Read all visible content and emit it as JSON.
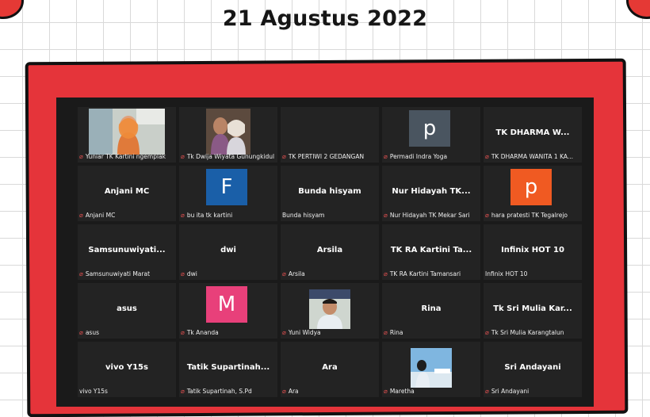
{
  "header": {
    "date_title": "21 Agustus 2022"
  },
  "colors": {
    "frame_red": "#e5343a",
    "tile_bg": "#232323",
    "mute_red": "#e05050"
  },
  "participants": [
    {
      "label": "Yuniar TK Kartini ngemplak",
      "muted": true,
      "kind": "video",
      "video": "woman-hijab-orange"
    },
    {
      "label": "Tk Dwija Wiyata Gunungkidul",
      "muted": true,
      "kind": "video",
      "video": "two-women"
    },
    {
      "label": "TK PERTIWI 2 GEDANGAN",
      "muted": true,
      "kind": "blank"
    },
    {
      "label": "Permadi Indra Yoga",
      "muted": true,
      "kind": "avatar",
      "letter": "p",
      "avatar_color": "#4a5560"
    },
    {
      "label": "TK DHARMA WANITA 1 KA...",
      "muted": true,
      "kind": "name",
      "center": "TK DHARMA W..."
    },
    {
      "label": "Anjani MC",
      "muted": true,
      "kind": "name",
      "center": "Anjani MC"
    },
    {
      "label": "bu ita tk kartini",
      "muted": true,
      "kind": "avatar",
      "letter": "F",
      "avatar_color": "#1a5fa8"
    },
    {
      "label": "Bunda hisyam",
      "muted": false,
      "kind": "name",
      "center": "Bunda hisyam"
    },
    {
      "label": "Nur Hidayah TK Mekar Sari",
      "muted": true,
      "kind": "name",
      "center": "Nur Hidayah TK..."
    },
    {
      "label": "hara pratesti TK Tegalrejo",
      "muted": true,
      "kind": "avatar",
      "letter": "p",
      "avatar_color": "#f05a22"
    },
    {
      "label": "Samsunuwiyati Marat",
      "muted": true,
      "kind": "name",
      "center": "Samsunuwiyati..."
    },
    {
      "label": "dwi",
      "muted": true,
      "kind": "name",
      "center": "dwi"
    },
    {
      "label": "Arsila",
      "muted": true,
      "kind": "name",
      "center": "Arsila"
    },
    {
      "label": "TK RA Kartini Tamansari",
      "muted": true,
      "kind": "name",
      "center": "TK RA Kartini Ta..."
    },
    {
      "label": "Infinix HOT 10",
      "muted": false,
      "kind": "name",
      "center": "Infinix HOT 10"
    },
    {
      "label": "asus",
      "muted": true,
      "kind": "name",
      "center": "asus"
    },
    {
      "label": "Tk Ananda",
      "muted": true,
      "kind": "avatar",
      "letter": "M",
      "avatar_color": "#e8407a"
    },
    {
      "label": "Yuni Widya",
      "muted": true,
      "kind": "video",
      "video": "man-office"
    },
    {
      "label": "Rina",
      "muted": true,
      "kind": "name",
      "center": "Rina"
    },
    {
      "label": "Tk Sri Mulia Karangtalun",
      "muted": true,
      "kind": "name",
      "center": "Tk Sri Mulia Kar..."
    },
    {
      "label": "vivo Y15s",
      "muted": false,
      "kind": "name",
      "center": "vivo Y15s"
    },
    {
      "label": "Tatik Supartinah, S.Pd",
      "muted": true,
      "kind": "name",
      "center": "Tatik  Supartinah..."
    },
    {
      "label": "Ara",
      "muted": true,
      "kind": "name",
      "center": "Ara"
    },
    {
      "label": "Maretha",
      "muted": true,
      "kind": "video",
      "video": "sky-scene"
    },
    {
      "label": "Sri Andayani",
      "muted": true,
      "kind": "name",
      "center": "Sri Andayani"
    }
  ]
}
